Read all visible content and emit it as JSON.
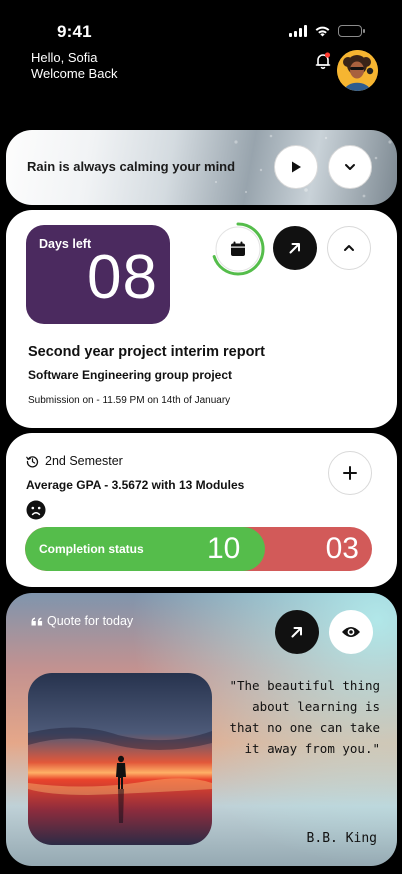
{
  "status_bar": {
    "time": "9:41"
  },
  "header": {
    "greeting_line1": "Hello, Sofia",
    "greeting_line2": "Welcome Back",
    "bell_icon": "bell-notification-icon",
    "avatar_icon": "user-avatar"
  },
  "rain_card": {
    "title": "Rain is always calming your mind",
    "play_icon": "play-icon",
    "expand_icon": "chevron-down-icon"
  },
  "days_card": {
    "label": "Days left",
    "days": "08",
    "progress": 0.7,
    "title": "Second year project interim report",
    "subtitle": "Software Engineering group project",
    "deadline": "Submission on - 11.59 PM on 14th of January",
    "colors": {
      "box": "#4B2A5F",
      "progress": "#55BD4B"
    }
  },
  "semester_card": {
    "label": "2nd Semester",
    "gpa": "Average GPA - 3.5672 with 13 Modules",
    "completion_label": "Completion status",
    "completed": "10",
    "remaining": "03",
    "completed_fraction": 0.6923,
    "colors": {
      "done": "#55BD4B",
      "remaining": "#D25A59"
    }
  },
  "quote_card": {
    "label": "Quote for today",
    "quote_lines": [
      "\"The beautiful thing",
      "about learning is",
      "that no one can take",
      "it away from you.\""
    ],
    "author": "B.B. King"
  }
}
